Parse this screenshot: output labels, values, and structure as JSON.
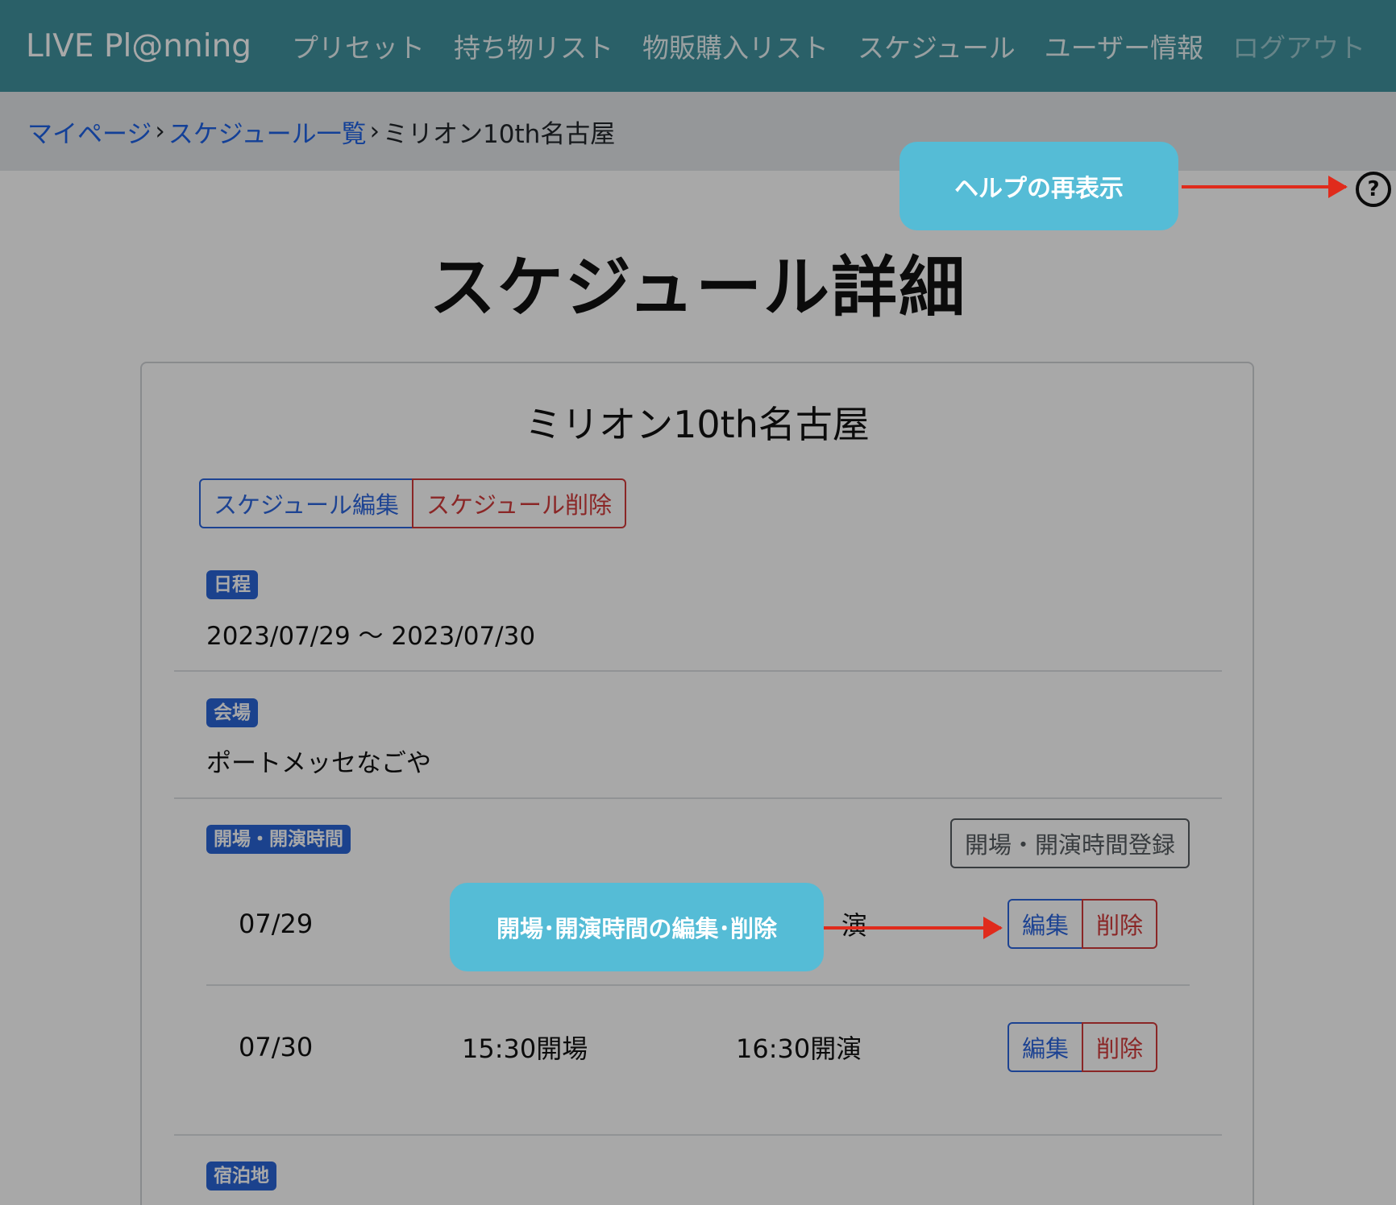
{
  "navbar": {
    "brand": "LIVE Pl@nning",
    "items": [
      "プリセット",
      "持ち物リスト",
      "物販購入リスト",
      "スケジュール",
      "ユーザー情報",
      "ログアウト"
    ]
  },
  "breadcrumb": {
    "items": [
      "マイページ",
      "スケジュール一覧",
      "ミリオン10th名古屋"
    ],
    "separator": "›"
  },
  "help": {
    "icon": "question-circle-icon",
    "glyph": "?"
  },
  "page": {
    "title": "スケジュール詳細"
  },
  "schedule": {
    "name": "ミリオン10th名古屋",
    "edit_label": "スケジュール編集",
    "delete_label": "スケジュール削除",
    "date": {
      "label": "日程",
      "value": "2023/07/29 〜 2023/07/30"
    },
    "venue": {
      "label": "会場",
      "value": "ポートメッセなごや"
    },
    "times": {
      "label": "開場・開演時間",
      "register_label": "開場・開演時間登録",
      "rows": [
        {
          "date": "07/29",
          "open": "",
          "start": "演",
          "edit": "編集",
          "delete": "削除"
        },
        {
          "date": "07/30",
          "open": "15:30開場",
          "start": "16:30開演",
          "edit": "編集",
          "delete": "削除"
        }
      ]
    },
    "lodging": {
      "label": "宿泊地"
    }
  },
  "callouts": {
    "help": "ヘルプの再表示",
    "times": "開場･開演時間の編集･削除"
  },
  "colors": {
    "navbar": "#41929f",
    "primary": "#2c66de",
    "danger": "#d23a3a",
    "callout": "#55bcd6",
    "arrow": "#e02b1c"
  }
}
